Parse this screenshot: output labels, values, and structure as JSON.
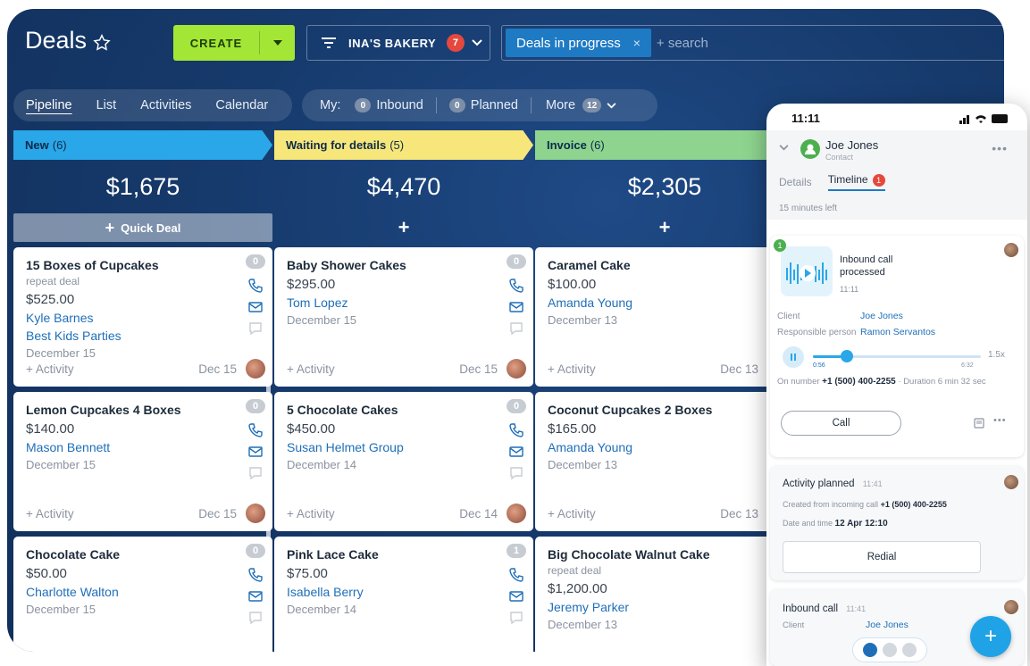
{
  "header": {
    "title": "Deals",
    "create_label": "CREATE",
    "filter_label": "INA'S BAKERY",
    "filter_badge": "7",
    "search_chip": "Deals in progress",
    "search_chip_remove": "×",
    "search_placeholder": "+ search"
  },
  "view_tabs": [
    "Pipeline",
    "List",
    "Activities",
    "Calendar"
  ],
  "my_filters": {
    "label": "My:",
    "inbound_count": "0",
    "inbound_label": "Inbound",
    "planned_count": "0",
    "planned_label": "Planned",
    "more_label": "More",
    "more_count": "12"
  },
  "columns": [
    {
      "name": "New",
      "count": "(6)",
      "total": "$1,675",
      "color": "#2aa7e8",
      "add_label": "Quick Deal",
      "cards": [
        {
          "title": "15 Boxes of Cupcakes",
          "sub": "repeat deal",
          "price": "$525.00",
          "links": [
            "Kyle Barnes",
            "Best Kids Parties"
          ],
          "date": "December 15",
          "activity": "+ Activity",
          "due": "Dec 15",
          "badge": "0"
        },
        {
          "title": "Lemon Cupcakes 4 Boxes",
          "sub": "",
          "price": "$140.00",
          "links": [
            "Mason Bennett"
          ],
          "date": "December 15",
          "activity": "+ Activity",
          "due": "Dec 15",
          "badge": "0"
        },
        {
          "title": "Chocolate Cake",
          "sub": "",
          "price": "$50.00",
          "links": [
            "Charlotte Walton"
          ],
          "date": "December 15",
          "activity": "",
          "due": "",
          "badge": "0"
        }
      ]
    },
    {
      "name": "Waiting for details",
      "count": "(5)",
      "total": "$4,470",
      "color": "#f7e77a",
      "add_label": "+",
      "cards": [
        {
          "title": "Baby Shower Cakes",
          "sub": "",
          "price": "$295.00",
          "links": [
            "Tom Lopez"
          ],
          "date": "December 15",
          "activity": "+ Activity",
          "due": "Dec 15",
          "badge": "0"
        },
        {
          "title": "5 Chocolate Cakes",
          "sub": "",
          "price": "$450.00",
          "links": [
            "Susan Helmet Group"
          ],
          "date": "December 14",
          "activity": "+ Activity",
          "due": "Dec 14",
          "badge": "0"
        },
        {
          "title": "Pink Lace Cake",
          "sub": "",
          "price": "$75.00",
          "links": [
            "Isabella Berry"
          ],
          "date": "December 14",
          "activity": "",
          "due": "",
          "badge": "1"
        }
      ]
    },
    {
      "name": "Invoice",
      "count": "(6)",
      "total": "$2,305",
      "color": "#8ed48f",
      "add_label": "+",
      "cards": [
        {
          "title": "Caramel Cake",
          "sub": "",
          "price": "$100.00",
          "links": [
            "Amanda Young"
          ],
          "date": "December 13",
          "activity": "+ Activity",
          "due": "Dec 13",
          "badge": "0"
        },
        {
          "title": "Coconut Cupcakes 2 Boxes",
          "sub": "",
          "price": "$165.00",
          "links": [
            "Amanda Young"
          ],
          "date": "December 13",
          "activity": "+ Activity",
          "due": "Dec 13",
          "badge": "0"
        },
        {
          "title": "Big Chocolate Walnut Cake",
          "sub": "repeat deal",
          "price": "$1,200.00",
          "links": [
            "Jeremy Parker"
          ],
          "date": "December 13",
          "activity": "",
          "due": "",
          "badge": "0"
        }
      ]
    }
  ],
  "phone": {
    "time": "11:11",
    "contact_name": "Joe Jones",
    "contact_role": "Contact",
    "tab_details": "Details",
    "tab_timeline": "Timeline",
    "timeline_badge": "1",
    "time_left": "15 minutes left",
    "call_card": {
      "marker": "1",
      "title": "Inbound call processed",
      "time": "11:11",
      "client_label": "Client",
      "client": "Joe Jones",
      "responsible_label": "Responsible person",
      "responsible": "Ramon Servantos",
      "speed": "1.5x",
      "elapsed": "0:56",
      "duration_total": "6:32",
      "on_number_label": "On number",
      "number": "+1 (500) 400-2255",
      "duration_text": "· Duration 6 min 32 sec",
      "call_label": "Call",
      "progress": 0.2
    },
    "activity_card": {
      "title": "Activity planned",
      "time": "11:41",
      "created_text": "Created from incoming call",
      "created_number": "+1 (500) 400-2255",
      "datetime_label": "Date and time",
      "datetime": "12 Apr 12:10",
      "redial_label": "Redial"
    },
    "inbound_card": {
      "title": "Inbound call",
      "time": "11:41",
      "client_label": "Client",
      "client": "Joe Jones"
    },
    "fab": "+"
  },
  "colors": {
    "accent": "#a3e635",
    "link": "#1f6fb8",
    "badge_red": "#e5483d",
    "fab": "#1fa3e6"
  }
}
